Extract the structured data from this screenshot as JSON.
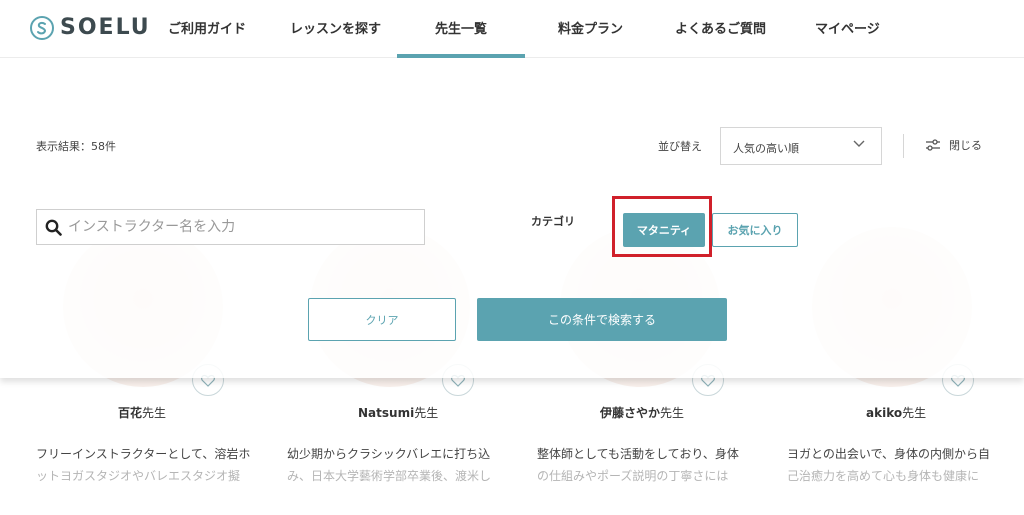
{
  "header": {
    "logo_text": "SOELU",
    "nav": [
      {
        "label": "ご利用ガイド"
      },
      {
        "label": "レッスンを探す"
      },
      {
        "label": "先生一覧"
      },
      {
        "label": "料金プラン"
      },
      {
        "label": "よくあるご質問"
      },
      {
        "label": "マイページ"
      }
    ]
  },
  "filter": {
    "result_count": "表示結果：58件",
    "sort_label": "並び替え",
    "sort_value": "人気の高い順",
    "close_label": "閉じる",
    "search_placeholder": "インストラクター名を入力",
    "category_label": "カテゴリ",
    "categories": [
      "マタニティ",
      "お気に入り"
    ],
    "clear_label": "クリア",
    "search_label": "この条件で検索する"
  },
  "teachers": [
    {
      "name": "百花",
      "suffix": "先生",
      "desc1": "フリーインストラクターとして、溶岩ホ",
      "desc2": "ットヨガスタジオやバレエスタジオ擬"
    },
    {
      "name": "Natsumi",
      "suffix": "先生",
      "desc1": "幼少期からクラシックバレエに打ち込",
      "desc2": "み、日本大学藝術学部卒業後、渡米し"
    },
    {
      "name": "伊藤さやか",
      "suffix": "先生",
      "desc1": "整体師としても活動をしており、身体",
      "desc2": "の仕組みやポーズ説明の丁寧さには"
    },
    {
      "name": "akiko",
      "suffix": "先生",
      "desc1": "ヨガとの出会いで、身体の内側から自",
      "desc2": "己治癒力を高めて心も身体も健康に"
    }
  ],
  "colors": {
    "accent": "#5ba3b0",
    "highlight": "#d0202a"
  }
}
